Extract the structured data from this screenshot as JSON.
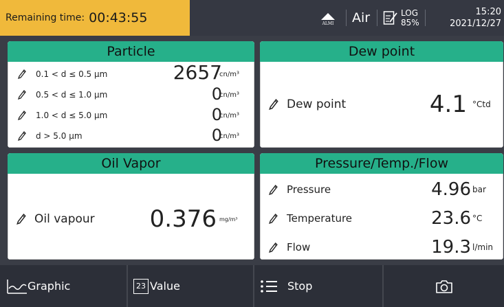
{
  "status": {
    "remaining_label": "Remaining time:",
    "remaining_value": "00:43:55",
    "alarm_label": "ALMI",
    "gas": "Air",
    "log_label": "LOG",
    "log_percent": "85%",
    "time": "15:20",
    "date": "2021/12/27"
  },
  "particle": {
    "title": "Particle",
    "rows": [
      {
        "label": "0.1 < d ≤ 0.5 µm",
        "value": "2657",
        "unit": "cn/m³"
      },
      {
        "label": "0.5 < d ≤ 1.0 µm",
        "value": "0",
        "unit": "cn/m³"
      },
      {
        "label": "1.0 < d ≤ 5.0 µm",
        "value": "0",
        "unit": "cn/m³"
      },
      {
        "label": "d > 5.0 µm",
        "value": "0",
        "unit": "cn/m³"
      }
    ]
  },
  "dewpoint": {
    "title": "Dew point",
    "label": "Dew point",
    "value": "4.1",
    "unit": "°Ctd"
  },
  "oil": {
    "title": "Oil Vapor",
    "label": "Oil vapour",
    "value": "0.376",
    "unit": "mg/m³"
  },
  "ptf": {
    "title": "Pressure/Temp./Flow",
    "rows": [
      {
        "label": "Pressure",
        "value": "4.96",
        "unit": "bar"
      },
      {
        "label": "Temperature",
        "value": "23.6",
        "unit": "°C"
      },
      {
        "label": "Flow",
        "value": "19.3",
        "unit": "l/min"
      }
    ]
  },
  "bottom": {
    "graphic": "Graphic",
    "value_icon_text": "23",
    "value": "Value",
    "stop": "Stop"
  },
  "colors": {
    "header_green": "#26b08a",
    "remaining_yellow": "#f0b93b"
  }
}
